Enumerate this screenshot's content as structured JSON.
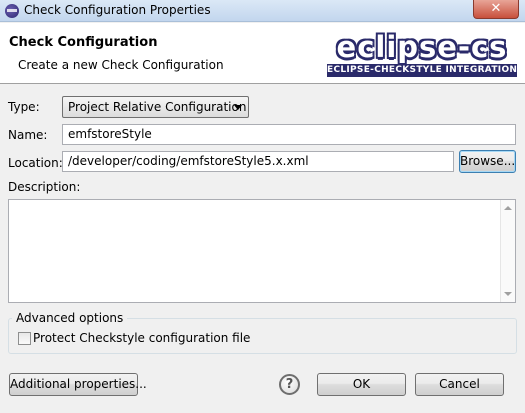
{
  "window": {
    "title": "Check Configuration Properties",
    "close_glyph": "✕"
  },
  "header": {
    "title": "Check Configuration",
    "subtitle": "Create a new Check Configuration",
    "logo_main": "eclipse-cs",
    "logo_tagline": "ECLIPSE-CHECKSTYLE INTEGRATION"
  },
  "form": {
    "type_label": "Type:",
    "type_value": "Project Relative Configuration",
    "name_label": "Name:",
    "name_value": "emfstoreStyle",
    "location_label": "Location:",
    "location_value": "/developer/coding/emfstoreStyle5.x.xml",
    "browse_label": "Browse...",
    "description_label": "Description:",
    "description_value": ""
  },
  "advanced": {
    "group_title": "Advanced options",
    "protect_label": "Protect Checkstyle configuration file",
    "protect_checked": false
  },
  "footer": {
    "additional_label": "Additional properties...",
    "help_glyph": "?",
    "ok_label": "OK",
    "cancel_label": "Cancel"
  },
  "icons": {
    "title_icon": "eclipse-icon",
    "help_icon": "help-icon"
  }
}
